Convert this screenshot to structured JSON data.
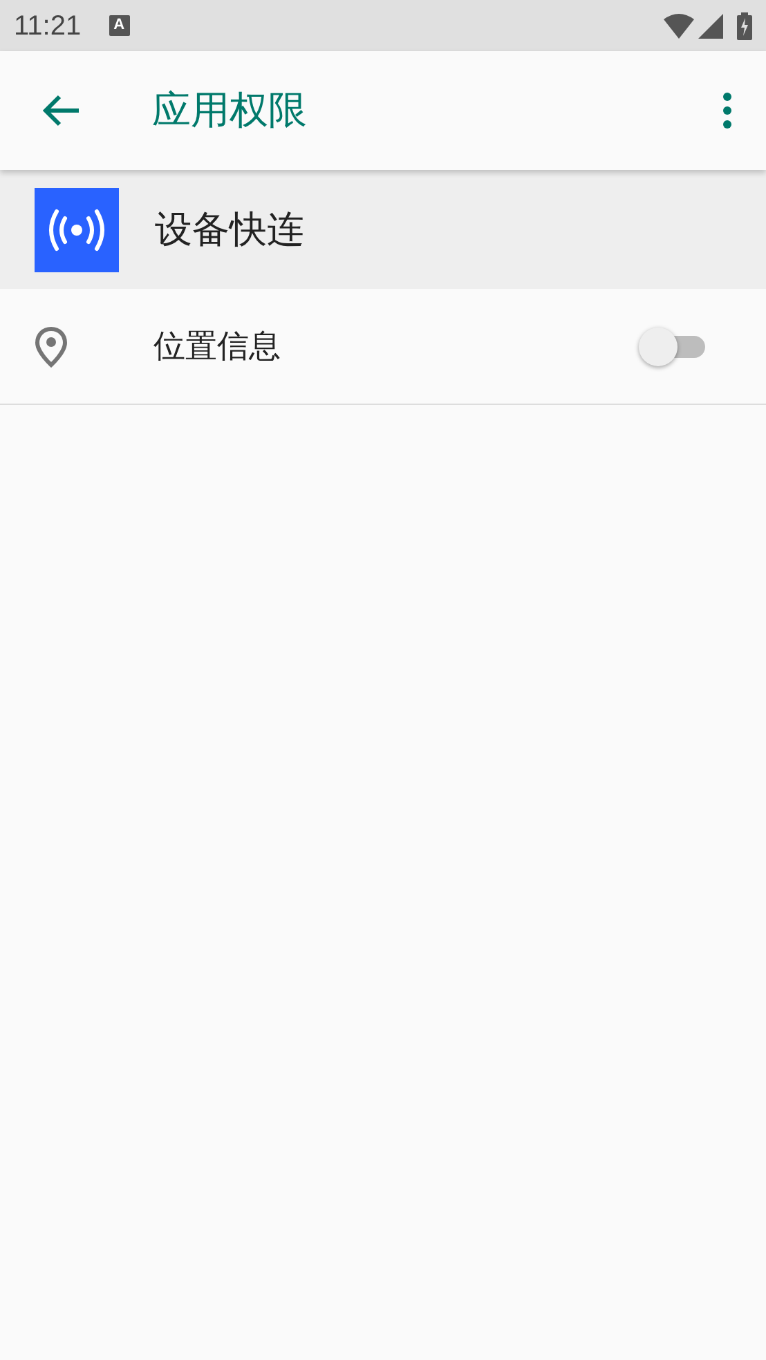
{
  "status_bar": {
    "time": "11:21",
    "notification": "A"
  },
  "toolbar": {
    "title": "应用权限"
  },
  "app": {
    "name": "设备快连"
  },
  "permissions": [
    {
      "label": "位置信息",
      "on": false
    }
  ]
}
